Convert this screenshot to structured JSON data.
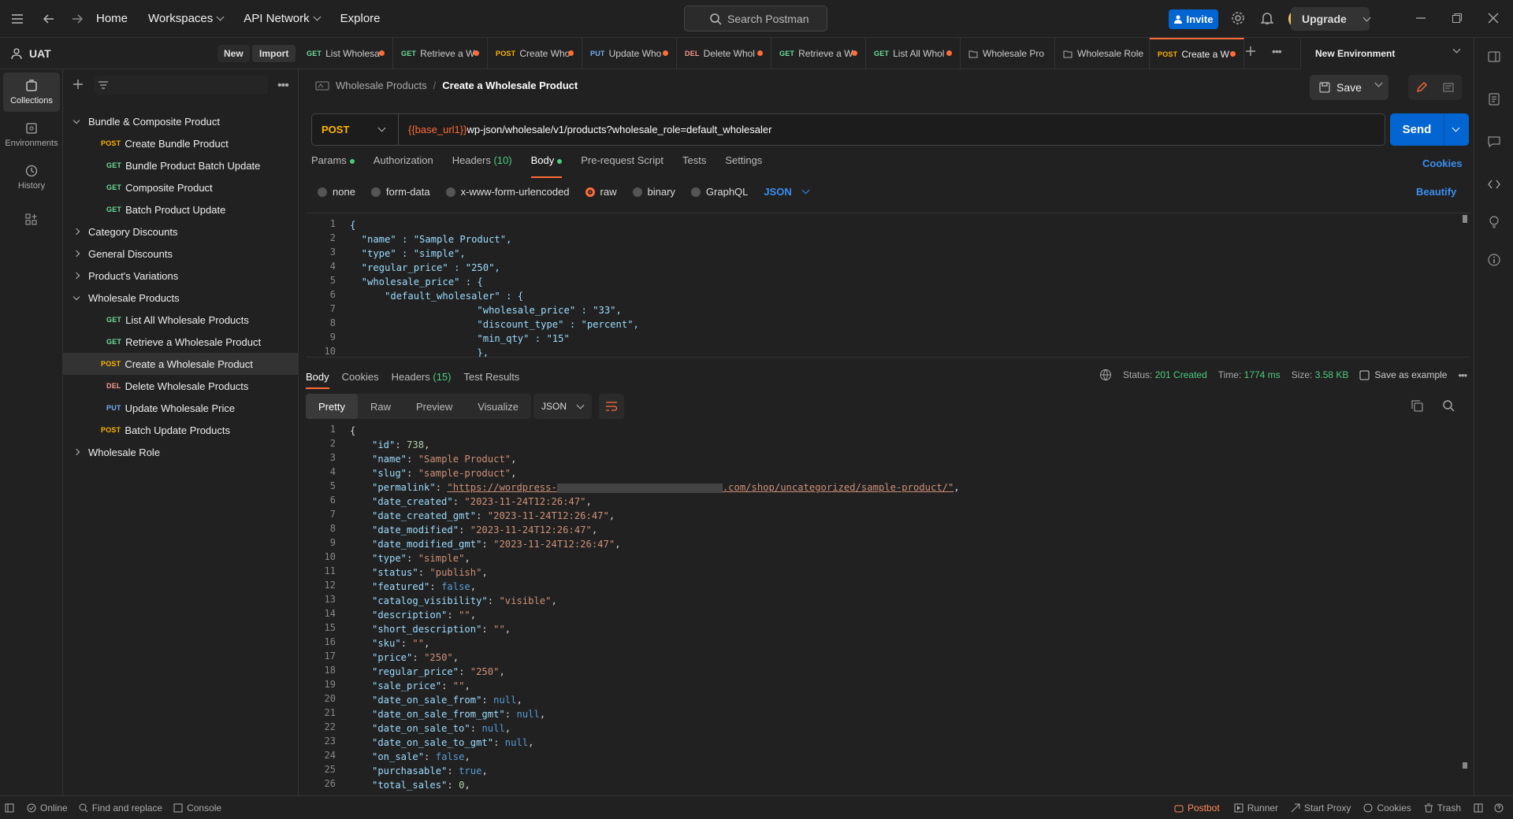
{
  "topbar": {
    "nav": [
      "Home",
      "Workspaces",
      "API Network",
      "Explore"
    ],
    "search_placeholder": "Search Postman",
    "invite_label": "Invite",
    "upgrade_label": "Upgrade"
  },
  "workspace": {
    "name": "UAT",
    "new_label": "New",
    "import_label": "Import"
  },
  "left_rail": [
    {
      "label": "Collections",
      "icon": "collections-icon"
    },
    {
      "label": "Environments",
      "icon": "environments-icon"
    },
    {
      "label": "History",
      "icon": "history-icon"
    }
  ],
  "sidebar": {
    "tree": [
      {
        "type": "folder",
        "label": "Bundle & Composite Product",
        "open": true
      },
      {
        "type": "request",
        "method": "POST",
        "label": "Create Bundle Product"
      },
      {
        "type": "request",
        "method": "GET",
        "label": "Bundle Product Batch Update"
      },
      {
        "type": "request",
        "method": "GET",
        "label": "Composite Product"
      },
      {
        "type": "request",
        "method": "GET",
        "label": "Batch Product Update"
      },
      {
        "type": "folder",
        "label": "Category Discounts",
        "open": false
      },
      {
        "type": "folder",
        "label": "General Discounts",
        "open": false
      },
      {
        "type": "folder",
        "label": "Product's Variations",
        "open": false
      },
      {
        "type": "folder",
        "label": "Wholesale Products",
        "open": true
      },
      {
        "type": "request",
        "method": "GET",
        "label": "List All Wholesale Products"
      },
      {
        "type": "request",
        "method": "GET",
        "label": "Retrieve a Wholesale Product"
      },
      {
        "type": "request",
        "method": "POST",
        "label": "Create a Wholesale Product",
        "selected": true
      },
      {
        "type": "request",
        "method": "DEL",
        "label": "Delete Wholesale Products"
      },
      {
        "type": "request",
        "method": "PUT",
        "label": "Update Wholesale Price"
      },
      {
        "type": "request",
        "method": "POST",
        "label": "Batch Update Products"
      },
      {
        "type": "folder",
        "label": "Wholesale Role",
        "open": false
      }
    ]
  },
  "tabs": [
    {
      "method": "GET",
      "label": "List Wholesa"
    },
    {
      "method": "GET",
      "label": "Retrieve a W"
    },
    {
      "method": "POST",
      "label": "Create Who"
    },
    {
      "method": "PUT",
      "label": "Update Who"
    },
    {
      "method": "DEL",
      "label": "Delete Whol"
    },
    {
      "method": "GET",
      "label": "Retrieve a W"
    },
    {
      "method": "GET",
      "label": "List All Whol"
    },
    {
      "method": "",
      "label": "Wholesale Pro"
    },
    {
      "method": "",
      "label": "Wholesale Role"
    },
    {
      "method": "POST",
      "label": "Create a W",
      "active": true
    }
  ],
  "environment": "New Environment",
  "request": {
    "breadcrumb_parent": "Wholesale Products",
    "breadcrumb_current": "Create a Wholesale Product",
    "save_label": "Save",
    "method": "POST",
    "url_var": "{{base_url1}}",
    "url_path": "wp-json/wholesale/v1/products?wholesale_role=default_wholesaler",
    "send_label": "Send",
    "tabs": [
      "Params",
      "Authorization",
      "Headers",
      "Body",
      "Pre-request Script",
      "Tests",
      "Settings"
    ],
    "headers_count": "(10)",
    "cookies_label": "Cookies",
    "body_modes": [
      "none",
      "form-data",
      "x-www-form-urlencoded",
      "raw",
      "binary",
      "GraphQL"
    ],
    "body_format": "JSON",
    "beautify_label": "Beautify",
    "body_lines": [
      "{",
      "  \"name\" : \"Sample Product\",",
      "  \"type\" : \"simple\",",
      "  \"regular_price\" : \"250\",",
      "  \"wholesale_price\" : {",
      "      \"default_wholesaler\" : {",
      "                      \"wholesale_price\" : \"33\",",
      "                      \"discount_type\" : \"percent\",",
      "                      \"min_qty\" : \"15\"",
      "                      },"
    ]
  },
  "response": {
    "tabs": [
      "Body",
      "Cookies",
      "Headers",
      "Test Results"
    ],
    "headers_count": "(15)",
    "status_label": "Status:",
    "status_value": "201 Created",
    "time_label": "Time:",
    "time_value": "1774 ms",
    "size_label": "Size:",
    "size_value": "3.58 KB",
    "save_example_label": "Save as example",
    "view_tabs": [
      "Pretty",
      "Raw",
      "Preview",
      "Visualize"
    ],
    "format": "JSON",
    "lines": [
      [
        "{",
        ""
      ],
      [
        "\"id\"",
        "738"
      ],
      [
        "\"name\"",
        "\"Sample Product\""
      ],
      [
        "\"slug\"",
        "\"sample-product\""
      ],
      [
        "\"permalink\"",
        "LINK"
      ],
      [
        "\"date_created\"",
        "\"2023-11-24T12:26:47\""
      ],
      [
        "\"date_created_gmt\"",
        "\"2023-11-24T12:26:47\""
      ],
      [
        "\"date_modified\"",
        "\"2023-11-24T12:26:47\""
      ],
      [
        "\"date_modified_gmt\"",
        "\"2023-11-24T12:26:47\""
      ],
      [
        "\"type\"",
        "\"simple\""
      ],
      [
        "\"status\"",
        "\"publish\""
      ],
      [
        "\"featured\"",
        "false"
      ],
      [
        "\"catalog_visibility\"",
        "\"visible\""
      ],
      [
        "\"description\"",
        "\"\""
      ],
      [
        "\"short_description\"",
        "\"\""
      ],
      [
        "\"sku\"",
        "\"\""
      ],
      [
        "\"price\"",
        "\"250\""
      ],
      [
        "\"regular_price\"",
        "\"250\""
      ],
      [
        "\"sale_price\"",
        "\"\""
      ],
      [
        "\"date_on_sale_from\"",
        "null"
      ],
      [
        "\"date_on_sale_from_gmt\"",
        "null"
      ],
      [
        "\"date_on_sale_to\"",
        "null"
      ],
      [
        "\"date_on_sale_to_gmt\"",
        "null"
      ],
      [
        "\"on_sale\"",
        "false"
      ],
      [
        "\"purchasable\"",
        "true"
      ],
      [
        "\"total_sales\"",
        "0"
      ]
    ],
    "permalink_start": "\"https://wordpress-",
    "permalink_end": ".com/shop/uncategorized/sample-product/\""
  },
  "footer": {
    "online": "Online",
    "find_replace": "Find and replace",
    "console": "Console",
    "postbot": "Postbot",
    "runner": "Runner",
    "start_proxy": "Start Proxy",
    "cookies": "Cookies",
    "trash": "Trash"
  },
  "colors": {
    "accent": "#ff6c37",
    "primary": "#0265d2",
    "success": "#4ccb7f"
  }
}
